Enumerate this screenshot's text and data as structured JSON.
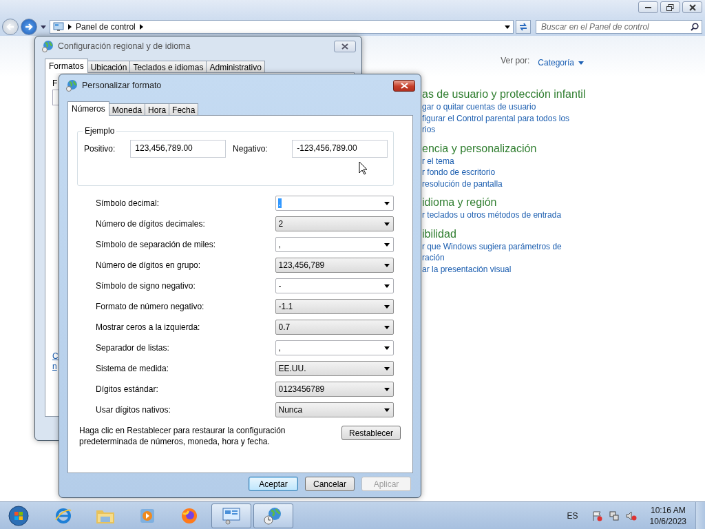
{
  "explorer": {
    "address": {
      "path": "Panel de control"
    },
    "search": {
      "placeholder": "Buscar en el Panel de control"
    },
    "view_by": {
      "label": "Ver por:",
      "value": "Categoría"
    },
    "categories": [
      {
        "title": "as de usuario y protección infantil",
        "links": [
          "gar o quitar cuentas de usuario",
          "figurar el Control parental para todos los",
          "rios"
        ]
      },
      {
        "title": "encia y personalización",
        "links": [
          "r el tema",
          "r fondo de escritorio",
          "resolución de pantalla"
        ]
      },
      {
        "title": "idioma y región",
        "links": [
          "r teclados u otros métodos de entrada"
        ]
      },
      {
        "title": "ibilidad",
        "links": [
          "r que Windows sugiera parámetros de",
          "ración",
          "ar la presentación visual"
        ]
      }
    ]
  },
  "regional_dialog": {
    "title": "Configuración regional y de idioma",
    "tabs": [
      {
        "label": "Formatos",
        "selected": true
      },
      {
        "label": "Ubicación",
        "selected": false
      },
      {
        "label": "Teclados e idiomas",
        "selected": false
      },
      {
        "label": "Administrativo",
        "selected": false
      }
    ],
    "label_fragment": "F",
    "link_fragments": [
      "C",
      "n"
    ]
  },
  "customize_dialog": {
    "title": "Personalizar formato",
    "tabs": [
      {
        "label": "Números",
        "selected": true
      },
      {
        "label": "Moneda",
        "selected": false
      },
      {
        "label": "Hora",
        "selected": false
      },
      {
        "label": "Fecha",
        "selected": false
      }
    ],
    "example": {
      "legend": "Ejemplo",
      "positive_label": "Positivo:",
      "positive": "123,456,789.00",
      "negative_label": "Negativo:",
      "negative": "-123,456,789.00"
    },
    "settings": [
      {
        "label": "Símbolo decimal:",
        "value": ".",
        "kind": "edit",
        "text_selected": true
      },
      {
        "label": "Número de dígitos decimales:",
        "value": "2",
        "kind": "list",
        "text_selected": false
      },
      {
        "label": "Símbolo de separación de miles:",
        "value": ",",
        "kind": "edit",
        "text_selected": false
      },
      {
        "label": "Número de dígitos en grupo:",
        "value": "123,456,789",
        "kind": "list",
        "text_selected": false
      },
      {
        "label": "Símbolo de signo negativo:",
        "value": "-",
        "kind": "edit",
        "text_selected": false
      },
      {
        "label": "Formato de número negativo:",
        "value": "-1.1",
        "kind": "list",
        "text_selected": false
      },
      {
        "label": "Mostrar ceros a la izquierda:",
        "value": "0.7",
        "kind": "list",
        "text_selected": false
      },
      {
        "label": "Separador de listas:",
        "value": ",",
        "kind": "edit",
        "text_selected": false
      },
      {
        "label": "Sistema de medida:",
        "value": "EE.UU.",
        "kind": "list",
        "text_selected": false
      },
      {
        "label": "Dígitos estándar:",
        "value": "0123456789",
        "kind": "list",
        "text_selected": false
      },
      {
        "label": "Usar dígitos nativos:",
        "value": "Nunca",
        "kind": "list",
        "text_selected": false
      }
    ],
    "note": "Haga clic en Restablecer para restaurar la configuración predeterminada de números, moneda, hora y fecha.",
    "reset_button": "Restablecer",
    "buttons": [
      {
        "label": "Aceptar",
        "default": true,
        "disabled": false
      },
      {
        "label": "Cancelar",
        "default": false,
        "disabled": false
      },
      {
        "label": "Aplicar",
        "default": false,
        "disabled": true
      }
    ]
  },
  "taskbar": {
    "apps": [
      {
        "kind": "browser",
        "active": false
      },
      {
        "kind": "folder",
        "active": false
      },
      {
        "kind": "media",
        "active": false
      },
      {
        "kind": "firefox",
        "active": false
      },
      {
        "kind": "control-panel",
        "active": true
      },
      {
        "kind": "globe-clock",
        "active": true
      }
    ],
    "language": "ES",
    "time": "10:16 AM",
    "date": "10/6/2023"
  }
}
